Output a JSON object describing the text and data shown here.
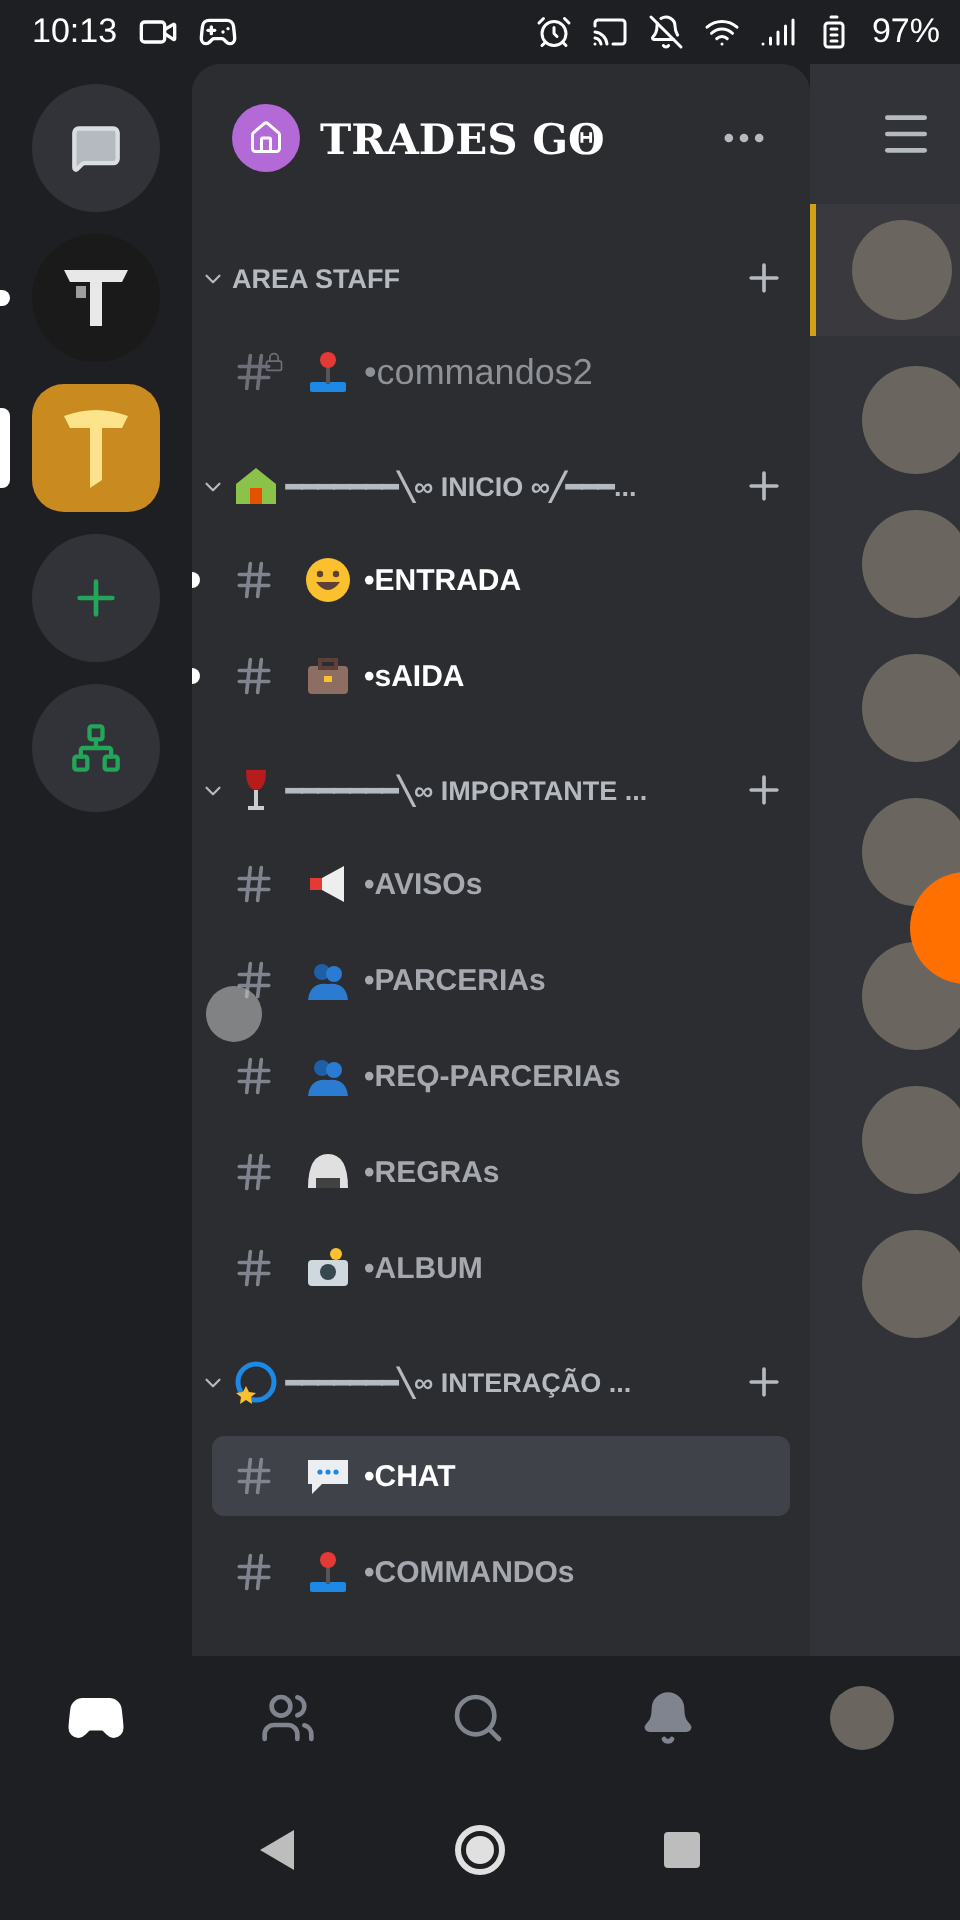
{
  "status_bar": {
    "time": "10:13",
    "battery": "97%"
  },
  "servers": [
    {
      "kind": "dm",
      "selected": false,
      "unread": false
    },
    {
      "kind": "dark-t",
      "selected": false,
      "unread": true
    },
    {
      "kind": "gold-t",
      "selected": true,
      "unread": false
    },
    {
      "kind": "add",
      "selected": false,
      "unread": false
    },
    {
      "kind": "explore",
      "selected": false,
      "unread": false
    }
  ],
  "server_header": {
    "name": "TRADES GΘ"
  },
  "categories": [
    {
      "name": "AREA STAFF",
      "expanded": true,
      "channels": [
        {
          "name": "•commandos2",
          "kind": "joystick",
          "locked": true,
          "unread": false,
          "selected": false
        }
      ]
    },
    {
      "kind": "house",
      "name": "━━━━━━━╲∞ INICIO ∞╱━━━...",
      "expanded": true,
      "channels": [
        {
          "name": "•ENTRADA",
          "kind": "smiley",
          "locked": false,
          "unread": true,
          "selected": false
        },
        {
          "name": "•sAIDA",
          "kind": "briefcase",
          "locked": false,
          "unread": true,
          "selected": false
        }
      ]
    },
    {
      "kind": "wine",
      "name": "━━━━━━━╲∞ IMPORTANTE ...",
      "expanded": true,
      "channels": [
        {
          "name": "•AVISOs",
          "kind": "megaphone",
          "locked": false,
          "unread": false,
          "selected": false
        },
        {
          "name": "•PARCERIAs",
          "kind": "people",
          "locked": false,
          "unread": false,
          "selected": false
        },
        {
          "name": "•REϘ-PARCERIAs",
          "kind": "people",
          "locked": false,
          "unread": false,
          "selected": false
        },
        {
          "name": "•REGRAs",
          "kind": "helmet",
          "locked": false,
          "unread": false,
          "selected": false
        },
        {
          "name": "•ALBUM",
          "kind": "camera",
          "locked": false,
          "unread": false,
          "selected": false
        }
      ]
    },
    {
      "kind": "comet",
      "name": "━━━━━━━╲∞ INTERAÇÃO ...",
      "expanded": true,
      "channels": [
        {
          "name": "•CHAT",
          "kind": "speech",
          "locked": false,
          "unread": false,
          "selected": true
        },
        {
          "name": "•COMMANDOs",
          "kind": "joystick",
          "locked": false,
          "unread": false,
          "selected": false
        }
      ]
    }
  ],
  "members": [
    {
      "highlighted": true
    },
    {
      "highlighted": false
    },
    {
      "highlighted": false
    },
    {
      "highlighted": false
    },
    {
      "highlighted": false
    },
    {
      "highlighted": false
    },
    {
      "highlighted": false
    },
    {
      "highlighted": false
    }
  ],
  "bottom_nav": [
    {
      "kind": "home",
      "selected": true
    },
    {
      "kind": "friends",
      "selected": false
    },
    {
      "kind": "search",
      "selected": false
    },
    {
      "kind": "notifications",
      "selected": false
    },
    {
      "kind": "profile",
      "selected": false
    }
  ]
}
